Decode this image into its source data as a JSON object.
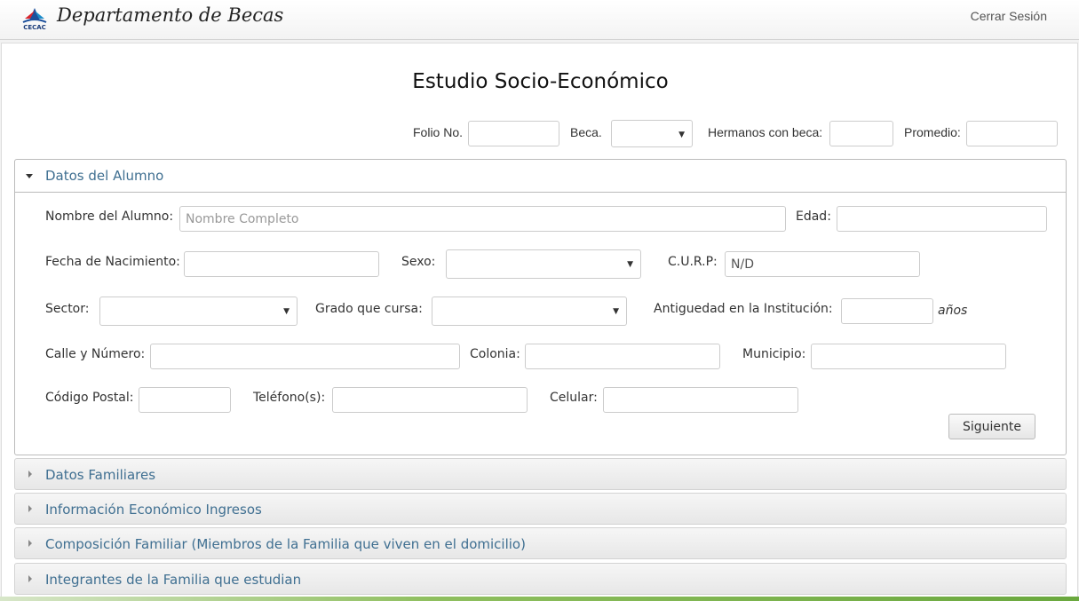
{
  "header": {
    "logo_text": "CECAC",
    "brand": "Departamento de Becas",
    "logout": "Cerrar Sesión"
  },
  "form": {
    "title": "Estudio Socio-Económico",
    "top_fields": {
      "folio_label": "Folio No.",
      "folio_value": "",
      "beca_label": "Beca.",
      "beca_value": "",
      "hermanos_label": "Hermanos con beca:",
      "hermanos_value": "",
      "promedio_label": "Promedio:",
      "promedio_value": ""
    },
    "datos_alumno": {
      "panel_title": "Datos del Alumno",
      "nombre_label": "Nombre del Alumno:",
      "nombre_placeholder": "Nombre Completo",
      "nombre_value": "",
      "edad_label": "Edad:",
      "edad_value": "",
      "fecha_label": "Fecha de Nacimiento:",
      "fecha_value": "",
      "sexo_label": "Sexo:",
      "sexo_value": "",
      "curp_label": "C.U.R.P:",
      "curp_value": "N/D",
      "sector_label": "Sector:",
      "sector_value": "",
      "grado_label": "Grado que cursa:",
      "grado_value": "",
      "antiguedad_label": "Antiguedad en la Institución:",
      "antiguedad_value": "",
      "antiguedad_unit": "años",
      "calle_label": "Calle y Número:",
      "calle_value": "",
      "colonia_label": "Colonia:",
      "colonia_value": "",
      "municipio_label": "Municipio:",
      "municipio_value": "",
      "cp_label": "Código Postal:",
      "cp_value": "",
      "telefono_label": "Teléfono(s):",
      "telefono_value": "",
      "celular_label": "Celular:",
      "celular_value": "",
      "next_button": "Siguiente"
    },
    "sections": [
      {
        "label": "Datos Familiares"
      },
      {
        "label": "Información Económico Ingresos"
      },
      {
        "label": "Composición Familiar (Miembros de la Familia que viven en el domicilio)"
      },
      {
        "label": "Integrantes de la Familia que estudian"
      }
    ]
  },
  "colors": {
    "accent_text": "#3f6f91",
    "panel_border": "#bbbbbb"
  }
}
